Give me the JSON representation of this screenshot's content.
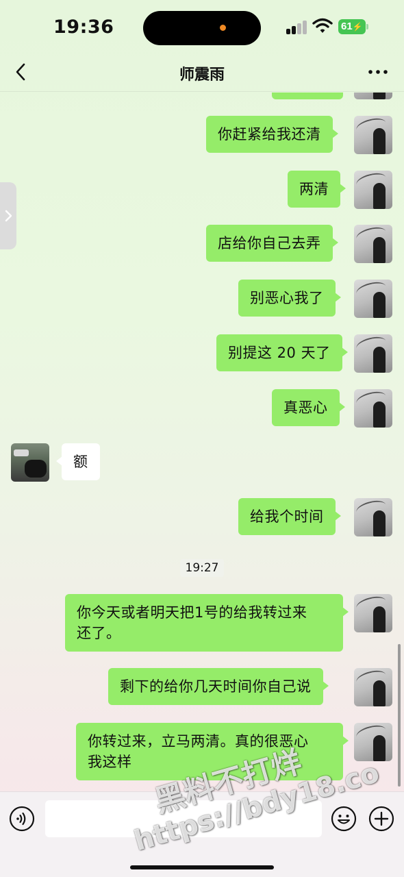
{
  "status_bar": {
    "time": "19:36",
    "battery": "61",
    "icons": [
      "signal-icon",
      "wifi-icon",
      "battery-charging-icon"
    ]
  },
  "nav": {
    "title": "师震雨",
    "icons": [
      "chevron-left-icon",
      "more-dots-icon"
    ]
  },
  "side_tab": {
    "icon": "chevron-right-icon"
  },
  "messages": [
    {
      "sender": "self",
      "text": "你赶紧给我还清"
    },
    {
      "sender": "self",
      "text": "两清"
    },
    {
      "sender": "self",
      "text": "店给你自己去弄"
    },
    {
      "sender": "self",
      "text": "别恶心我了"
    },
    {
      "sender": "self",
      "text": "别提这 20 天了"
    },
    {
      "sender": "self",
      "text": "真恶心"
    },
    {
      "sender": "other",
      "text": "额"
    },
    {
      "sender": "self",
      "text": "给我个时间"
    },
    {
      "timestamp": "19:27"
    },
    {
      "sender": "self",
      "text_line1": "你今天或者明天把1号的给我转过来",
      "text_line2": "还了。"
    },
    {
      "sender": "self",
      "text": "剩下的给你几天时间你自己说"
    },
    {
      "sender": "self",
      "text_line1": "你转过来，立马两清。真的很恶心",
      "text_line2": "我这样"
    }
  ],
  "input_bar": {
    "placeholder": "",
    "icons": [
      "voice-icon",
      "emoji-icon",
      "plus-icon"
    ]
  },
  "watermark": {
    "line1": "黑料不打烊",
    "line2": "https://bdy18.co"
  }
}
